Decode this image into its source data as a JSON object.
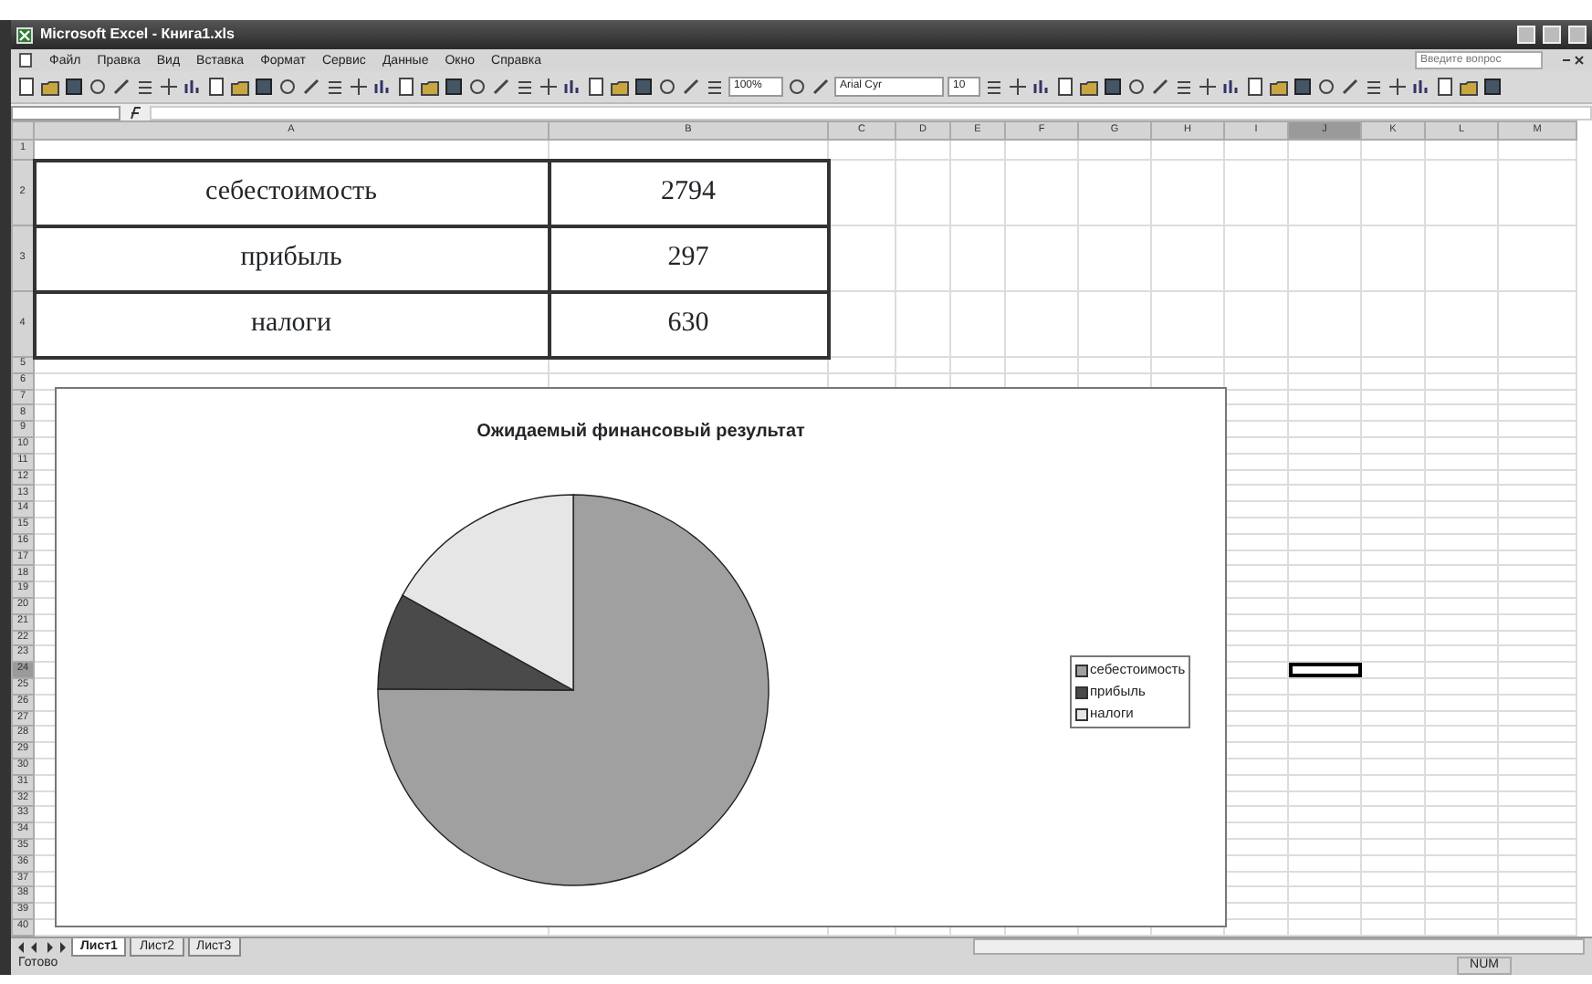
{
  "window": {
    "title": "Microsoft Excel - Книга1.xls"
  },
  "menu": [
    "Файл",
    "Правка",
    "Вид",
    "Вставка",
    "Формат",
    "Сервис",
    "Данные",
    "Окно",
    "Справка"
  ],
  "help_search": {
    "placeholder": "Введите вопрос"
  },
  "toolbar": {
    "zoom": "100%",
    "font": "Arial Cyr",
    "font_size": "10"
  },
  "columns": [
    {
      "header": "A",
      "selected": false
    },
    {
      "header": "B",
      "selected": false
    },
    {
      "header": "C",
      "selected": false
    },
    {
      "header": "D",
      "selected": false
    },
    {
      "header": "E",
      "selected": false
    },
    {
      "header": "F",
      "selected": false
    },
    {
      "header": "G",
      "selected": false
    },
    {
      "header": "H",
      "selected": false
    },
    {
      "header": "I",
      "selected": false
    },
    {
      "header": "J",
      "selected": true
    },
    {
      "header": "K",
      "selected": false
    },
    {
      "header": "L",
      "selected": false
    },
    {
      "header": "M",
      "selected": false
    }
  ],
  "rows": [
    {
      "header": "1",
      "kind": "short",
      "selected": false
    },
    {
      "header": "2",
      "kind": "tall",
      "selected": false,
      "cells": [
        "себестоимость",
        "2794"
      ]
    },
    {
      "header": "3",
      "kind": "tall",
      "selected": false,
      "cells": [
        "прибыль",
        "297"
      ]
    },
    {
      "header": "4",
      "kind": "tall",
      "selected": false,
      "cells": [
        "налоги",
        "630"
      ]
    },
    {
      "header": "5",
      "kind": "short",
      "selected": false
    },
    {
      "header": "6",
      "kind": "short",
      "selected": false
    },
    {
      "header": "7",
      "kind": "short",
      "selected": false
    },
    {
      "header": "8",
      "kind": "short",
      "selected": false
    },
    {
      "header": "9",
      "kind": "short",
      "selected": false
    },
    {
      "header": "10",
      "kind": "short",
      "selected": false
    },
    {
      "header": "11",
      "kind": "short",
      "selected": false
    },
    {
      "header": "12",
      "kind": "short",
      "selected": false
    },
    {
      "header": "13",
      "kind": "short",
      "selected": false
    },
    {
      "header": "14",
      "kind": "short",
      "selected": false
    },
    {
      "header": "15",
      "kind": "short",
      "selected": false
    },
    {
      "header": "16",
      "kind": "short",
      "selected": false
    },
    {
      "header": "17",
      "kind": "short",
      "selected": false
    },
    {
      "header": "18",
      "kind": "short",
      "selected": false
    },
    {
      "header": "19",
      "kind": "short",
      "selected": false
    },
    {
      "header": "20",
      "kind": "short",
      "selected": false
    },
    {
      "header": "21",
      "kind": "short",
      "selected": false
    },
    {
      "header": "22",
      "kind": "short",
      "selected": false
    },
    {
      "header": "23",
      "kind": "short",
      "selected": false
    },
    {
      "header": "24",
      "kind": "short",
      "selected": true
    },
    {
      "header": "25",
      "kind": "short",
      "selected": false
    },
    {
      "header": "26",
      "kind": "short",
      "selected": false
    },
    {
      "header": "27",
      "kind": "short",
      "selected": false
    },
    {
      "header": "28",
      "kind": "short",
      "selected": false
    },
    {
      "header": "29",
      "kind": "short",
      "selected": false
    },
    {
      "header": "30",
      "kind": "short",
      "selected": false
    },
    {
      "header": "31",
      "kind": "short",
      "selected": false
    },
    {
      "header": "32",
      "kind": "short",
      "selected": false
    },
    {
      "header": "33",
      "kind": "short",
      "selected": false
    },
    {
      "header": "34",
      "kind": "short",
      "selected": false
    },
    {
      "header": "35",
      "kind": "short",
      "selected": false
    },
    {
      "header": "36",
      "kind": "short",
      "selected": false
    },
    {
      "header": "37",
      "kind": "short",
      "selected": false
    },
    {
      "header": "38",
      "kind": "short",
      "selected": false
    },
    {
      "header": "39",
      "kind": "short",
      "selected": false
    },
    {
      "header": "40",
      "kind": "short",
      "selected": false
    }
  ],
  "chart": {
    "slices": [
      {
        "color": "#a0a0a0"
      },
      {
        "color": "#4a4a4a"
      },
      {
        "color": "#e6e6e6"
      }
    ],
    "chart_data": {
      "type": "pie",
      "title": "Ожидаемый финансовый результат",
      "categories": [
        "себестоимость",
        "прибыль",
        "налоги"
      ],
      "values": [
        75.09,
        7.98,
        16.93
      ],
      "legend": "right"
    }
  },
  "sheet_tabs": [
    {
      "label": "Лист1",
      "selected": true
    },
    {
      "label": "Лист2",
      "selected": false
    },
    {
      "label": "Лист3",
      "selected": false
    }
  ],
  "status_bar": {
    "message": "Готово",
    "indicator": "NUM"
  }
}
